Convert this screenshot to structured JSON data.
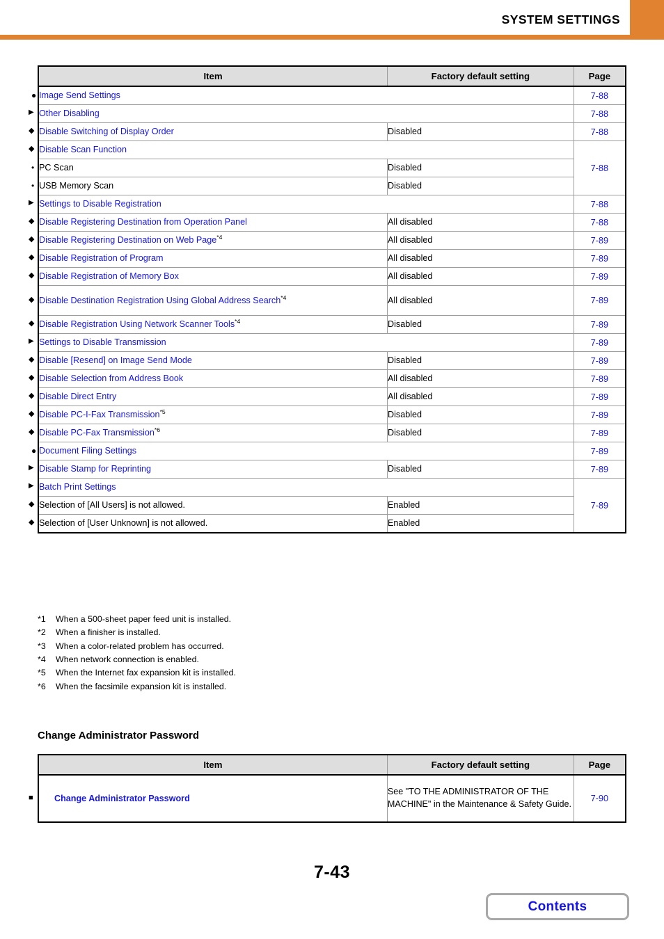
{
  "header": {
    "title": "SYSTEM SETTINGS",
    "accent_color": "#e0822f"
  },
  "link_color": "#1515e8",
  "table_security": {
    "columns": {
      "item": "Item",
      "factory": "Factory default setting",
      "page": "Page"
    },
    "rows": [
      {
        "label": "Image Send Settings",
        "bullet": "dot",
        "level": 0,
        "style": "link",
        "factory": "",
        "page": "7-88",
        "span_item_factory": true
      },
      {
        "label": "Other Disabling",
        "bullet": "tri",
        "level": 1,
        "style": "link",
        "factory": "",
        "page": "7-88",
        "span_item_factory": true
      },
      {
        "label": "Disable Switching of Display Order",
        "bullet": "dia",
        "level": 2,
        "style": "link",
        "factory": "Disabled",
        "page": "7-88"
      },
      {
        "label": "Disable Scan Function",
        "bullet": "dia",
        "level": 2,
        "style": "link",
        "factory": "",
        "page": "7-88",
        "span_item_factory": true,
        "page_rowspan": 3
      },
      {
        "label": "PC Scan",
        "bullet": "dot-small",
        "level": 3,
        "style": "black",
        "factory": "Disabled",
        "page": ""
      },
      {
        "label": "USB Memory Scan",
        "bullet": "dot-small",
        "level": 3,
        "style": "black",
        "factory": "Disabled",
        "page": ""
      },
      {
        "label": "Settings to Disable Registration",
        "bullet": "tri",
        "level": 1,
        "style": "link",
        "factory": "",
        "page": "7-88",
        "span_item_factory": true
      },
      {
        "label": "Disable Registering Destination from Operation Panel",
        "bullet": "dia",
        "level": 2,
        "style": "link",
        "factory": "All disabled",
        "page": "7-88"
      },
      {
        "label": "Disable Registering Destination on Web Page",
        "footnote": "*4",
        "bullet": "dia",
        "level": 2,
        "style": "link",
        "factory": "All disabled",
        "page": "7-89"
      },
      {
        "label": "Disable Registration of Program",
        "bullet": "dia",
        "level": 2,
        "style": "link",
        "factory": "All disabled",
        "page": "7-89"
      },
      {
        "label": "Disable Registration of Memory Box",
        "bullet": "dia",
        "level": 2,
        "style": "link",
        "factory": "All disabled",
        "page": "7-89"
      },
      {
        "label": "Disable Destination Registration Using Global Address Search",
        "footnote": "*4",
        "bullet": "dia",
        "level": 2,
        "style": "link",
        "factory": "All disabled",
        "page": "7-89",
        "tall": true
      },
      {
        "label": "Disable Registration Using Network Scanner Tools",
        "footnote": "*4",
        "bullet": "dia",
        "level": 2,
        "style": "link",
        "factory": "Disabled",
        "page": "7-89"
      },
      {
        "label": "Settings to Disable Transmission",
        "bullet": "tri",
        "level": 1,
        "style": "link",
        "factory": "",
        "page": "7-89",
        "span_item_factory": true
      },
      {
        "label": "Disable [Resend] on Image Send Mode",
        "bullet": "dia",
        "level": 2,
        "style": "link",
        "factory": "Disabled",
        "page": "7-89"
      },
      {
        "label": "Disable Selection from Address Book",
        "bullet": "dia",
        "level": 2,
        "style": "link",
        "factory": "All disabled",
        "page": "7-89"
      },
      {
        "label": "Disable Direct Entry",
        "bullet": "dia",
        "level": 2,
        "style": "link",
        "factory": "All disabled",
        "page": "7-89"
      },
      {
        "label": "Disable PC-I-Fax Transmission",
        "footnote": "*5",
        "bullet": "dia",
        "level": 2,
        "style": "link",
        "factory": "Disabled",
        "page": "7-89"
      },
      {
        "label": "Disable PC-Fax Transmission",
        "footnote": "*6",
        "bullet": "dia",
        "level": 2,
        "style": "link",
        "factory": "Disabled",
        "page": "7-89"
      },
      {
        "label": "Document Filing Settings",
        "bullet": "dot",
        "level": 0,
        "style": "link",
        "factory": "",
        "page": "7-89",
        "span_item_factory": true
      },
      {
        "label": "Disable Stamp for Reprinting",
        "bullet": "tri",
        "level": 1,
        "style": "link",
        "factory": "Disabled",
        "page": "7-89"
      },
      {
        "label": "Batch Print Settings",
        "bullet": "tri",
        "level": 1,
        "style": "link",
        "factory": "",
        "page": "7-89",
        "span_item_factory": true,
        "page_rowspan": 3
      },
      {
        "label": "Selection of [All Users] is not allowed.",
        "bullet": "dia",
        "level": 2,
        "style": "black",
        "factory": "Enabled",
        "page": ""
      },
      {
        "label": "Selection of [User Unknown] is not allowed.",
        "bullet": "dia",
        "level": 2,
        "style": "black",
        "factory": "Enabled",
        "page": ""
      }
    ]
  },
  "footnotes": [
    {
      "mark": "*1",
      "text": "When a 500-sheet paper feed unit is installed."
    },
    {
      "mark": "*2",
      "text": "When a finisher is installed."
    },
    {
      "mark": "*3",
      "text": "When a color-related problem has occurred."
    },
    {
      "mark": "*4",
      "text": "When network connection is enabled."
    },
    {
      "mark": "*5",
      "text": "When the Internet fax expansion kit is installed."
    },
    {
      "mark": "*6",
      "text": "When the facsimile expansion kit is installed."
    }
  ],
  "section_admin": {
    "title": "Change Administrator Password",
    "columns": {
      "item": "Item",
      "factory": "Factory default setting",
      "page": "Page"
    },
    "row": {
      "label": "Change Administrator Password",
      "bullet": "sq",
      "factory": "See \"TO THE ADMINISTRATOR OF THE MACHINE\" in the Maintenance & Safety Guide.",
      "page": "7-90"
    }
  },
  "footer": {
    "page_number": "7-43",
    "contents_button": "Contents"
  }
}
